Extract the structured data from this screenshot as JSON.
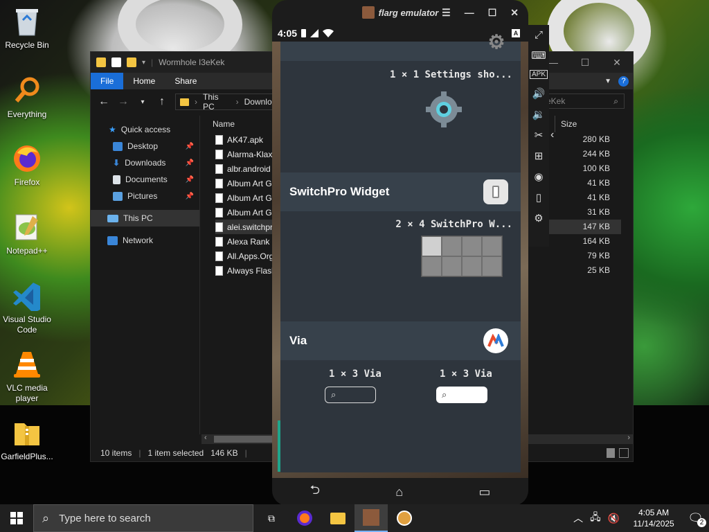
{
  "desktop": {
    "icons": [
      {
        "label": "Recycle Bin"
      },
      {
        "label": "Everything"
      },
      {
        "label": "Firefox"
      },
      {
        "label": "Notepad++"
      },
      {
        "label": "Visual Studio Code"
      },
      {
        "label": "VLC media player"
      },
      {
        "label": "GarfieldPlus..."
      }
    ]
  },
  "explorer": {
    "title": "Wormhole I3eKek",
    "search_placeholder": "I3eKek",
    "ribbon_tabs": [
      "File",
      "Home",
      "Share"
    ],
    "breadcrumb": [
      "This PC",
      "Downloads"
    ],
    "nav": [
      {
        "label": "Quick access"
      },
      {
        "label": "Desktop"
      },
      {
        "label": "Downloads"
      },
      {
        "label": "Documents"
      },
      {
        "label": "Pictures"
      },
      {
        "label": "This PC"
      },
      {
        "label": "Network"
      }
    ],
    "columns": {
      "name": "Name",
      "size": "Size"
    },
    "files": [
      {
        "name": "AK47.apk",
        "size": "280 KB"
      },
      {
        "name": "Alarma-Klax",
        "size": "244 KB"
      },
      {
        "name": "albr.android",
        "size": "100 KB"
      },
      {
        "name": "Album Art G",
        "size": "41 KB"
      },
      {
        "name": "Album Art G",
        "size": "41 KB"
      },
      {
        "name": "Album Art G",
        "size": "31 KB"
      },
      {
        "name": "alei.switchpr",
        "size": "147 KB"
      },
      {
        "name": "Alexa Rank 1",
        "size": "164 KB"
      },
      {
        "name": "All.Apps.Org",
        "size": "79 KB"
      },
      {
        "name": "Always Flash",
        "size": "25 KB"
      }
    ],
    "status": {
      "items": "10 items",
      "selected": "1 item selected",
      "size": "146 KB"
    }
  },
  "emulator": {
    "title": "flarg emulator",
    "phone_time": "4:05",
    "widgets": [
      {
        "caption": "1 × 1 Settings sho..."
      },
      {
        "app": "SwitchPro Widget",
        "caption": "2 × 4 SwitchPro W..."
      },
      {
        "app": "Via",
        "caption_left": "1 × 3 Via",
        "caption_right": "1 × 3 Via"
      }
    ]
  },
  "taskbar": {
    "search_placeholder": "Type here to search",
    "time": "4:05 AM",
    "date": "11/14/2025",
    "notification_count": "2"
  },
  "colors": {
    "accent": "#1a6ed8",
    "drawer_bg": "#2e353d",
    "header_bg": "#37414b",
    "scroll_indicator": "#1fa58a"
  }
}
